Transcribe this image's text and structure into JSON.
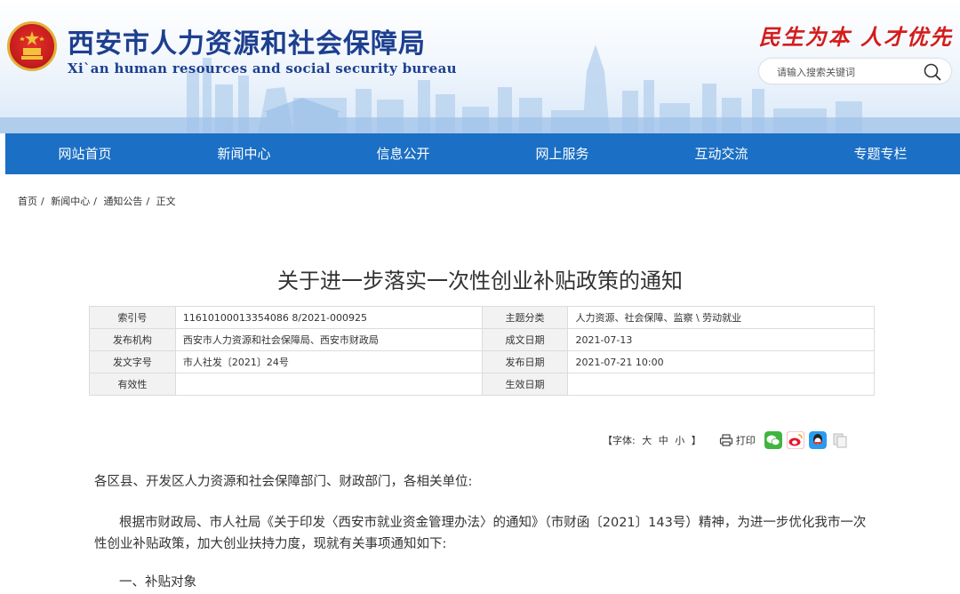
{
  "header": {
    "site_name_cn": "西安市人力资源和社会保障局",
    "site_name_en": "Xi`an human resources and social security bureau",
    "slogan": "民生为本 人才优先",
    "search_placeholder": "请输入搜索关键词"
  },
  "nav": [
    "网站首页",
    "新闻中心",
    "信息公开",
    "网上服务",
    "互动交流",
    "专题专栏"
  ],
  "breadcrumb": [
    "首页",
    "新闻中心",
    "通知公告",
    "正文"
  ],
  "breadcrumb_sep": "/",
  "article": {
    "title": "关于进一步落实一次性创业补贴政策的通知",
    "meta": {
      "index_label": "索引号",
      "index_value": "11610100013354086 8/2021-000925",
      "topic_label": "主题分类",
      "topic_value": "人力资源、社会保障、监察 \\ 劳动就业",
      "issuer_label": "发布机构",
      "issuer_value": "西安市人力资源和社会保障局、西安市财政局",
      "written_label": "成文日期",
      "written_value": "2021-07-13",
      "docno_label": "发文字号",
      "docno_value": "市人社发〔2021〕24号",
      "published_label": "发布日期",
      "published_value": "2021-07-21 10:00",
      "validity_label": "有效性",
      "validity_value": "",
      "effective_label": "生效日期",
      "effective_value": ""
    },
    "tools": {
      "font_label": "【字体:",
      "font_large": "大",
      "font_medium": "中",
      "font_small": "小",
      "font_end": "】",
      "print_label": "打印"
    },
    "paragraphs": {
      "p1": "各区县、开发区人力资源和社会保障部门、财政部门，各相关单位:",
      "p2a": "根据市财政局、市人社局《关于印发〈西安市就业资金管理办法〉的通知》（市财函〔2021〕143号）精神，为进一步优化我市一次",
      "p2b": "性创业补贴政策，加大创业扶持力度，现就有关事项通知如下:",
      "h1": "一、补贴对象"
    }
  },
  "colors": {
    "nav_bg": "#1b6fc4",
    "title_blue": "#1d3f8f",
    "slogan_red": "#d41c1c"
  },
  "icons": [
    "search-icon",
    "print-icon",
    "wechat-icon",
    "weibo-icon",
    "qq-icon",
    "copy-icon"
  ]
}
